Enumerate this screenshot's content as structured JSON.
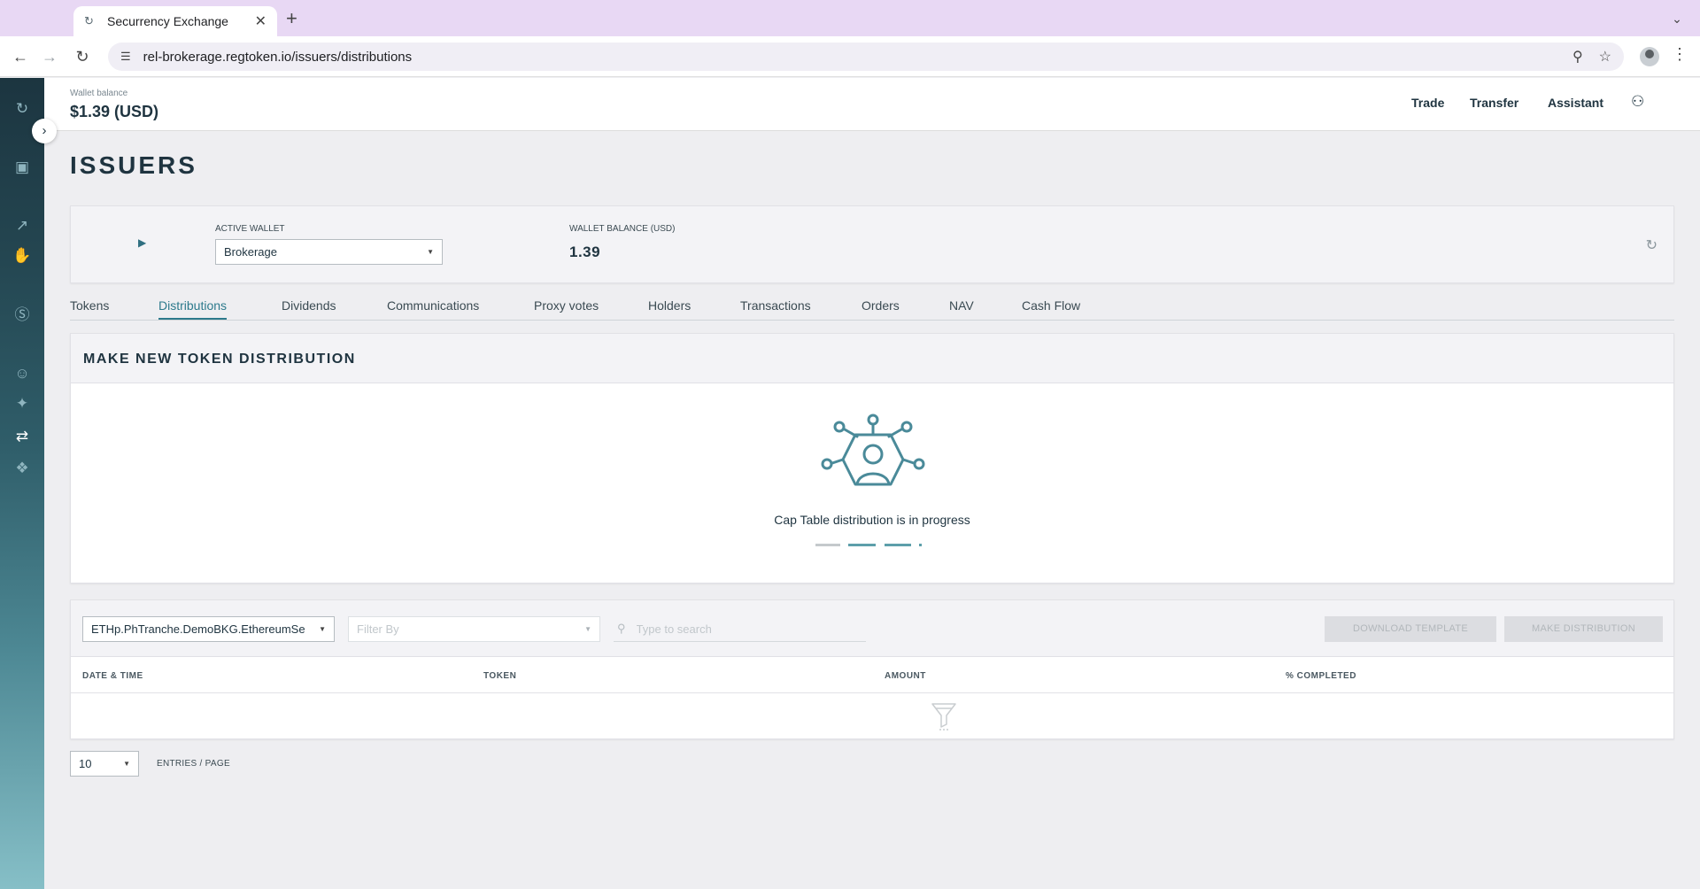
{
  "browser": {
    "tab_title": "Securrency Exchange",
    "url": "rel-brokerage.regtoken.io/issuers/distributions"
  },
  "header": {
    "wallet_balance_label": "Wallet balance",
    "wallet_balance_value": "$1.39 (USD)",
    "links": [
      "Trade",
      "Transfer",
      "Assistant"
    ]
  },
  "page": {
    "title": "ISSUERS"
  },
  "wallet_card": {
    "active_wallet_label": "ACTIVE WALLET",
    "active_wallet_value": "Brokerage",
    "balance_label": "WALLET BALANCE (USD)",
    "balance_value": "1.39"
  },
  "tabs": [
    "Tokens",
    "Distributions",
    "Dividends",
    "Communications",
    "Proxy votes",
    "Holders",
    "Transactions",
    "Orders",
    "NAV",
    "Cash Flow"
  ],
  "active_tab": "Distributions",
  "distribution": {
    "title": "MAKE NEW TOKEN DISTRIBUTION",
    "message": "Cap Table distribution is in progress"
  },
  "table": {
    "token_select_value": "ETHp.PhTranche.DemoBKG.EthereumSe",
    "filter_placeholder": "Filter By",
    "search_placeholder": "Type to search",
    "download_template_label": "DOWNLOAD TEMPLATE",
    "make_distribution_label": "MAKE DISTRIBUTION",
    "columns": [
      "DATE & TIME",
      "TOKEN",
      "AMOUNT",
      "% COMPLETED"
    ]
  },
  "pagination": {
    "per_page_value": "10",
    "entries_label": "ENTRIES / PAGE"
  },
  "colors": {
    "accent": "#2d7a8c",
    "dark_text": "#1f3440",
    "sidebar_top": "#1c3540",
    "sidebar_bottom": "#86bfc7",
    "page_bg": "#eeeef1"
  },
  "icons": {
    "sidebar": [
      "sync-icon",
      "wallet-icon",
      "trending-up-icon",
      "chart-hand-icon",
      "dollar-icon",
      "people-icon",
      "handshake-icon",
      "user-transfer-icon",
      "token-flow-icon"
    ]
  }
}
